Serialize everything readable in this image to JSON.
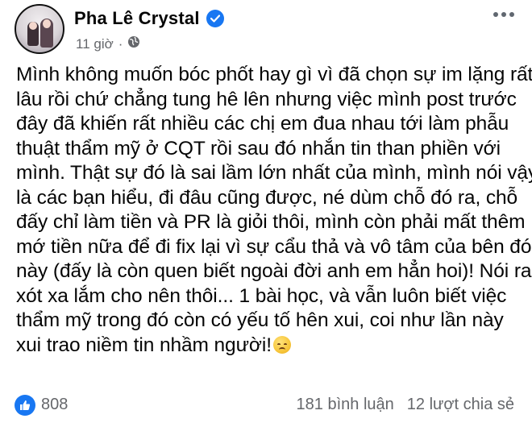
{
  "author": {
    "name": "Pha Lê Crystal",
    "verified": true,
    "time": "11 giờ",
    "separator": "·",
    "privacy_icon": "globe-icon"
  },
  "post": {
    "lines": [
      "Mình không muốn bóc phốt hay gì vì đã chọn sự im lặng rất",
      "lâu rồi chứ chẳng tung hê lên nhưng việc mình post trước",
      "đây đã khiến rất nhiều các chị em đua nhau tới làm phẫu",
      "thuật thẩm mỹ ở CQT rồi sau đó nhắn tin than phiền với",
      "mình. Thật sự đó là sai lầm lớn nhất của mình, mình nói vậy",
      "là các bạn hiểu, đi đâu cũng được, né dùm chỗ đó ra, chỗ",
      "đấy chỉ làm tiền và PR là giỏi thôi, mình còn phải mất thêm",
      "mớ tiền nữa để đi fix lại vì sự cẩu thả và vô tâm của bên đó",
      "này (đấy là còn quen biết ngoài đời anh em hẳn hoi)! Nói ra",
      "xót xa lắm cho nên thôi... 1 bài học, và vẫn luôn biết việc",
      "thẩm mỹ trong đó còn có yếu tố hên xui, coi như lần này",
      "xui trao niềm tin nhầm người!"
    ],
    "trailing_emoji": "disappointed-face-emoji"
  },
  "footer": {
    "likes": "808",
    "comments": "181 bình luận",
    "shares": "12 lượt chia sẻ"
  },
  "colors": {
    "facebook_blue": "#1877f2",
    "meta_gray": "#65676b",
    "text": "#050505"
  }
}
